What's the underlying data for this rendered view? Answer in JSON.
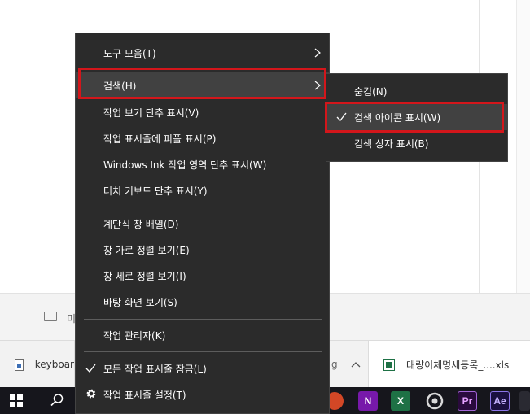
{
  "background": {
    "strip_text": "미"
  },
  "download_bar": {
    "item1_name": "keyboar",
    "item2_partial": "g",
    "item2_chevron": "^",
    "item3_name": "대량이체명세등록_....xls"
  },
  "taskbar": {
    "apps": [
      "PowerPoint",
      "OneNote",
      "Excel",
      "OBS",
      "Premiere Pro",
      "After Effects"
    ],
    "onenote_glyph": "N",
    "excel_glyph": "X",
    "premiere_glyph": "Pr",
    "ae_glyph": "Ae"
  },
  "context_menu": {
    "toolbars": "도구 모음(T)",
    "search": "검색(H)",
    "task_view": "작업 보기 단추 표시(V)",
    "people": "작업 표시줄에 피플 표시(P)",
    "windows_ink": "Windows Ink 작업 영역 단추 표시(W)",
    "touch_keyboard": "터치 키보드 단추 표시(Y)",
    "cascade": "계단식 창 배열(D)",
    "stacked": "창 가로 정렬 보기(E)",
    "side_by_side": "창 세로 정렬 보기(I)",
    "show_desktop": "바탕 화면 보기(S)",
    "task_manager": "작업 관리자(K)",
    "lock_taskbar": "모든 작업 표시줄 잠금(L)",
    "taskbar_settings": "작업 표시줄 설정(T)"
  },
  "search_submenu": {
    "hidden": "숨김(N)",
    "show_icon": "검색 아이콘 표시(W)",
    "show_box": "검색 상자 표시(B)",
    "selected": "show_icon"
  },
  "colors": {
    "menu_bg": "#2b2b2b",
    "menu_highlight": "#414141",
    "annotation_red": "#d3161b",
    "taskbar_bg": "#16161c"
  }
}
